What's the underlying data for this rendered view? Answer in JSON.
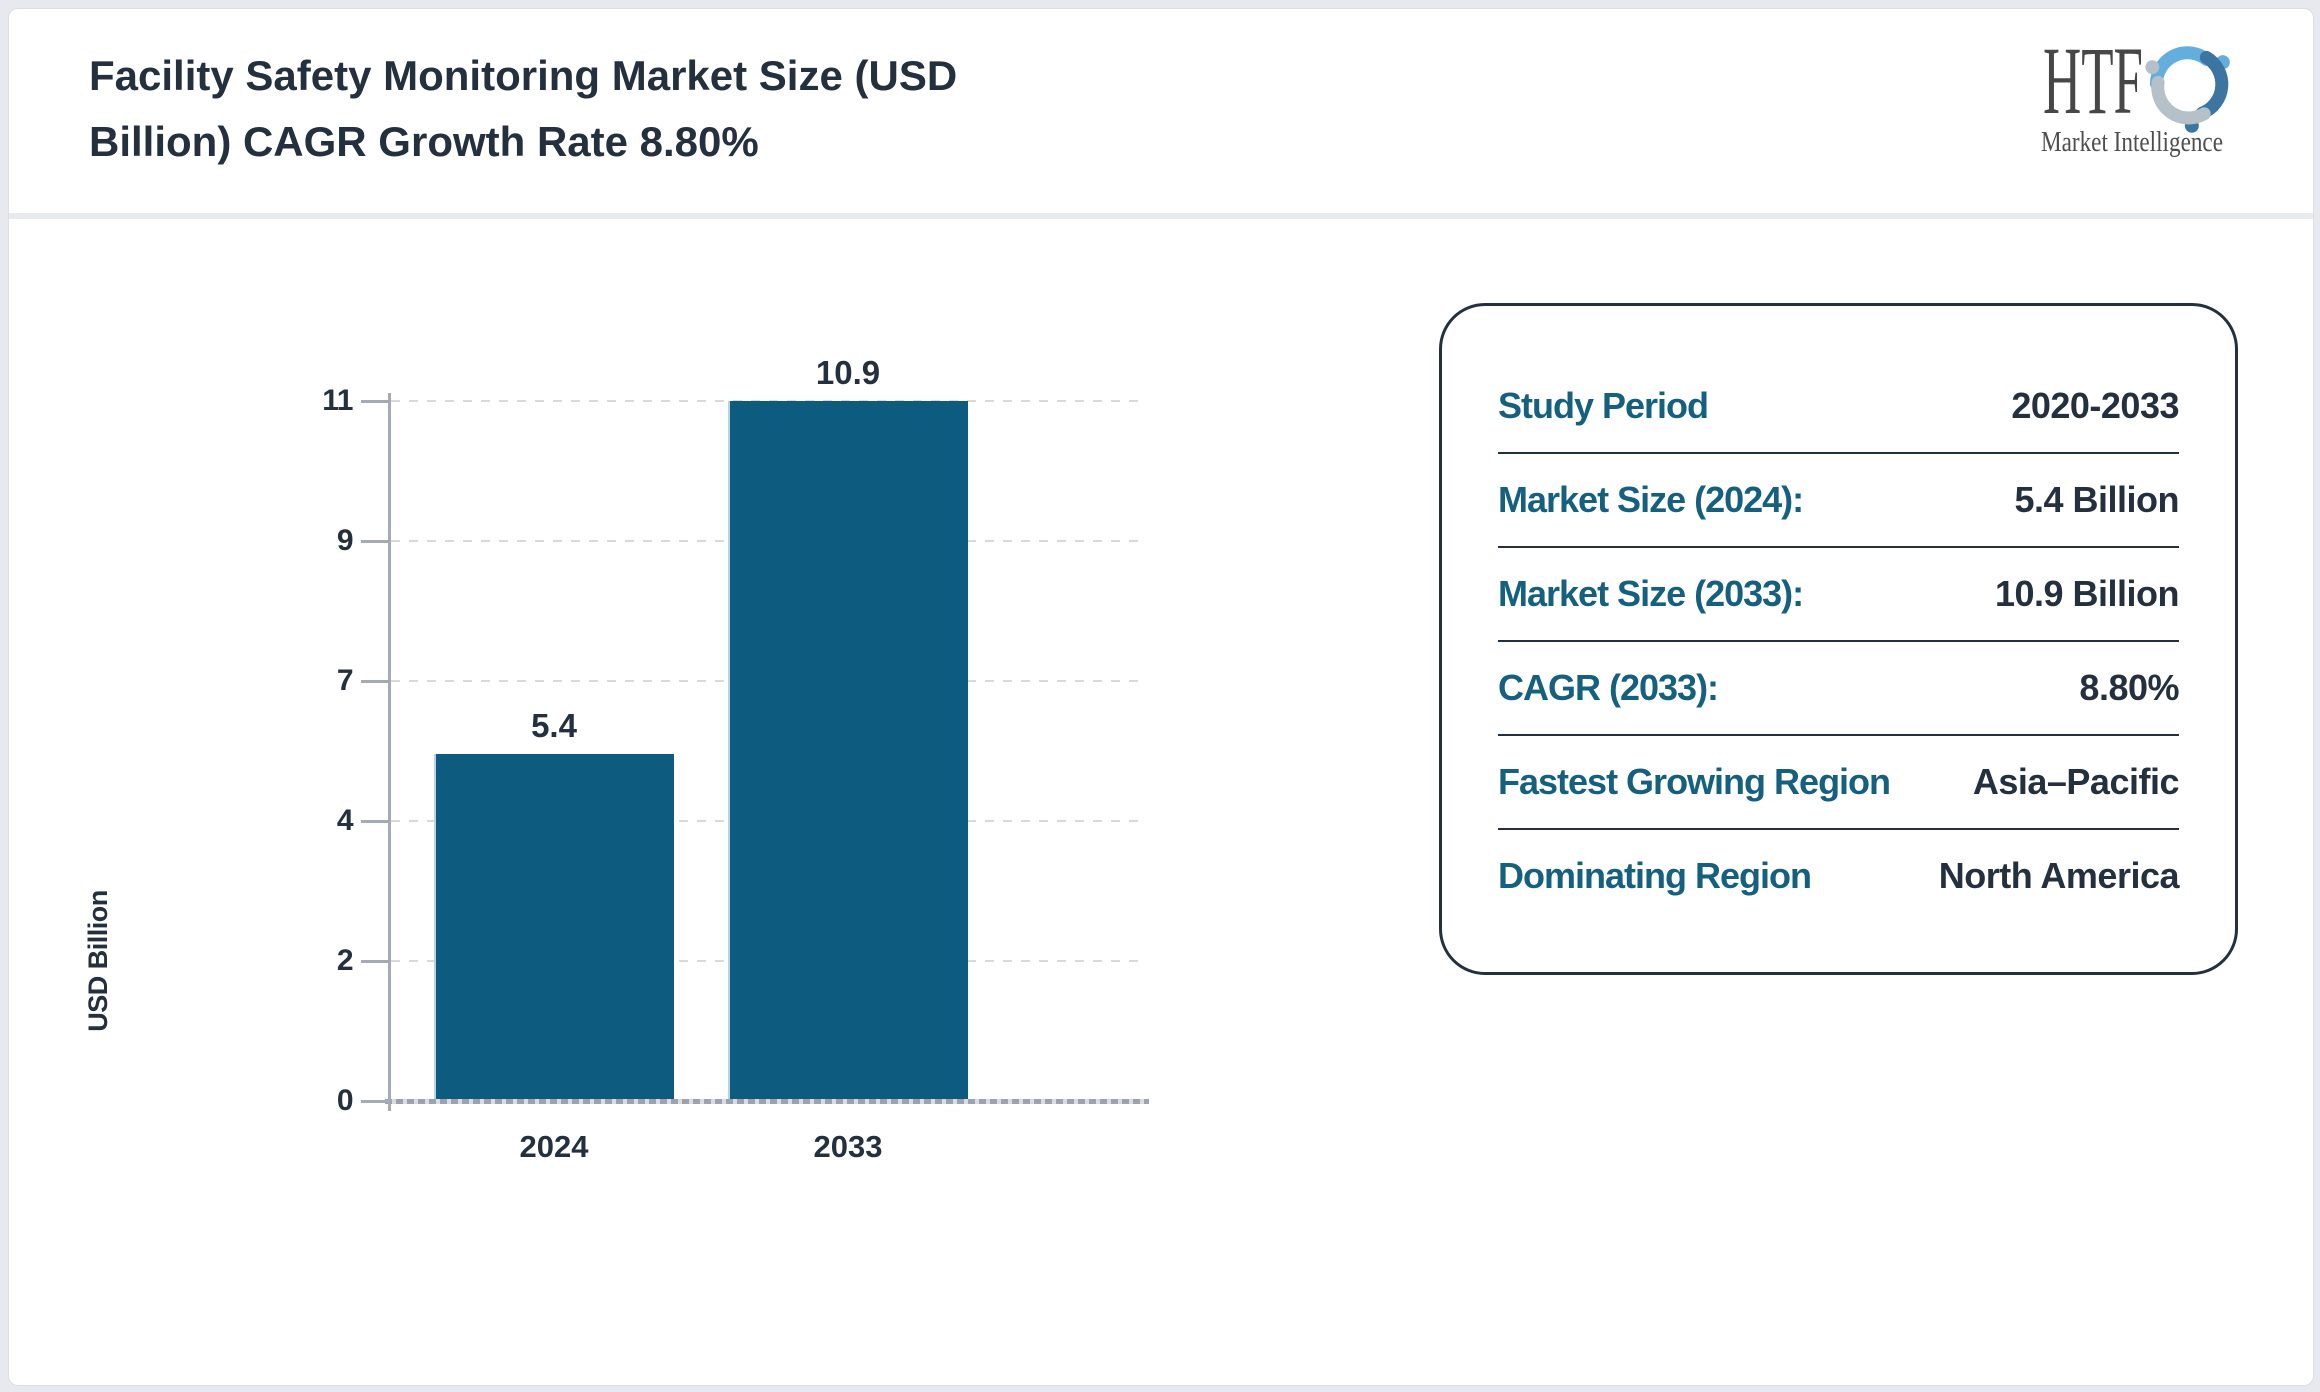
{
  "header": {
    "title_lines": [
      "Facility Safety Monitoring Market Size (USD",
      "Billion) CAGR Growth Rate 8.80%"
    ],
    "logo": {
      "text": "HTF",
      "subtext": "Market Intelligence"
    }
  },
  "chart_data": {
    "type": "bar",
    "title": "Facility Safety Monitoring Market Size (USD Billion) CAGR Growth Rate 8.80%",
    "categories": [
      "2024",
      "2033"
    ],
    "values": [
      5.4,
      10.9
    ],
    "bar_value_labels": [
      "5.4",
      "10.9"
    ],
    "xlabel": "",
    "ylabel": "USD Billion",
    "ylim": [
      0,
      10.9
    ],
    "ytick_labels": [
      "0",
      "2",
      "4",
      "7",
      "9",
      "11"
    ],
    "grid": "horizontal-dashed",
    "legend": "none",
    "bar_color": "#0d5c80"
  },
  "summary": {
    "rows": [
      {
        "label": "Study Period",
        "value": "2020-2033"
      },
      {
        "label": "Market Size (2024):",
        "value": "5.4 Billion"
      },
      {
        "label": "Market Size (2033):",
        "value": "10.9 Billion"
      },
      {
        "label": "CAGR (2033):",
        "value": "8.80%"
      },
      {
        "label": "Fastest Growing Region",
        "value": "Asia–Pacific"
      },
      {
        "label": "Dominating Region",
        "value": "North America"
      }
    ]
  },
  "colors": {
    "page_background": "#e8e9ee",
    "dark_navy_text": "#25303e",
    "accent_teal_label": "#15607f",
    "bar_fill": "#0d5c80",
    "axis_gray": "#a4abb4",
    "gridline_gray": "#d9d9d9"
  }
}
